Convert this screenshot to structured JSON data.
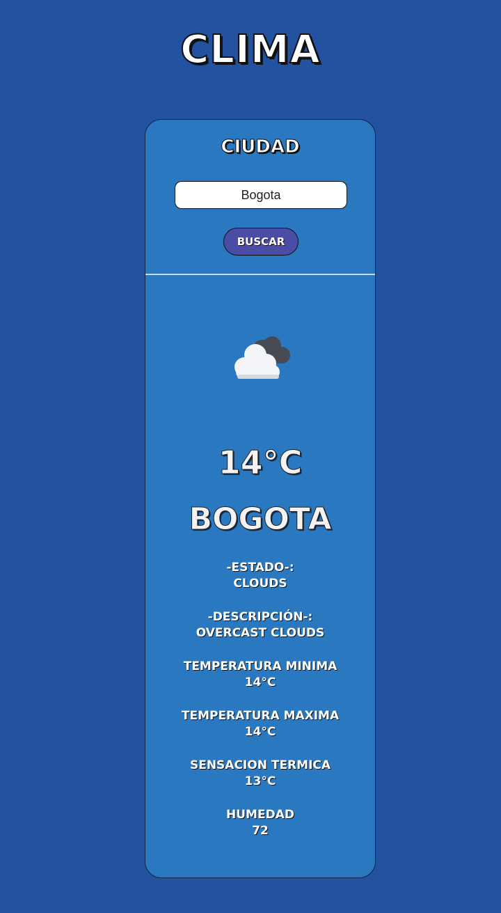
{
  "header": {
    "title": "CLIMA"
  },
  "search": {
    "label": "CIUDAD",
    "value": "Bogota",
    "button_label": "BUSCAR"
  },
  "weather": {
    "icon": "cloud-icon",
    "temperature": "14°C",
    "city": "BOGOTA",
    "details": [
      {
        "label": "-ESTADO-:",
        "value": "CLOUDS"
      },
      {
        "label": "-DESCRIPCIÓN-:",
        "value": "OVERCAST CLOUDS"
      },
      {
        "label": "TEMPERATURA MINIMA",
        "value": "14°C"
      },
      {
        "label": "TEMPERATURA MAXIMA",
        "value": "14°C"
      },
      {
        "label": "SENSACION TERMICA",
        "value": "13°C"
      },
      {
        "label": "HUMEDAD",
        "value": "72"
      }
    ]
  },
  "colors": {
    "background": "#2252a0",
    "card": "#2a78c0",
    "button": "#4b4ca6",
    "divider": "#c9dced"
  }
}
